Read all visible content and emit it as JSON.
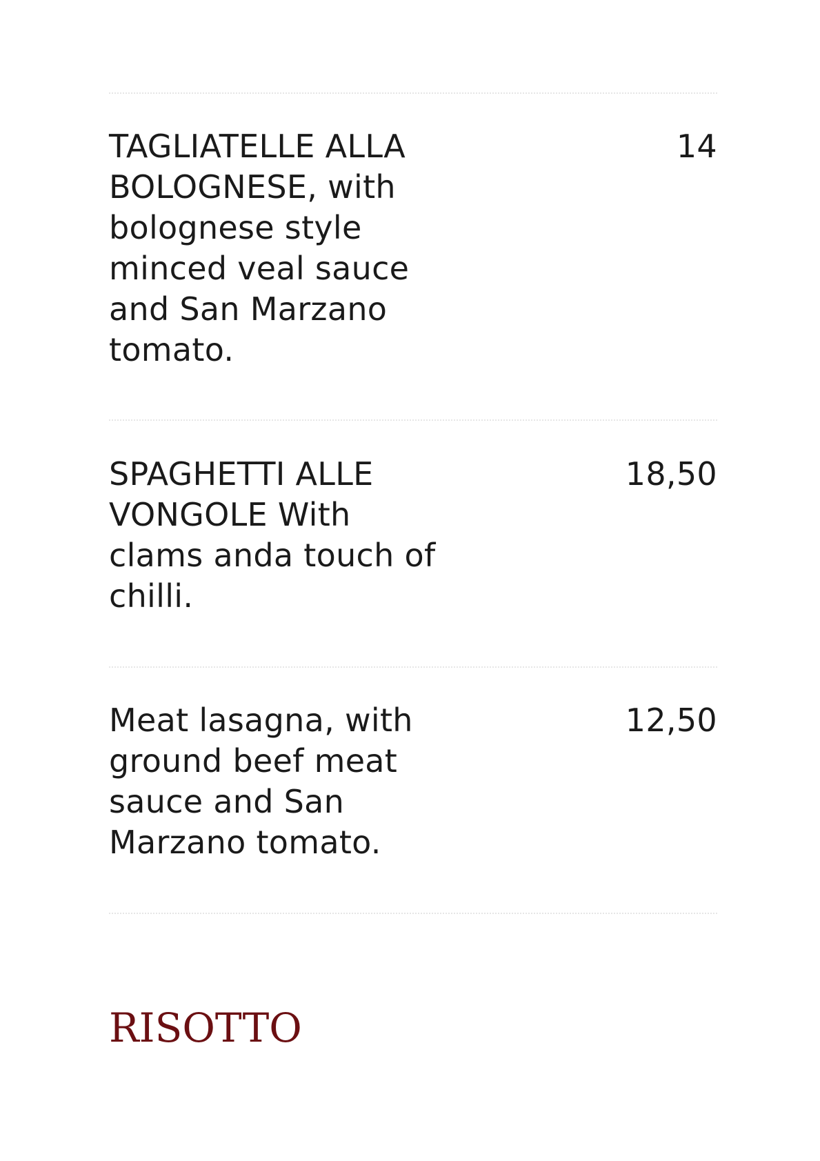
{
  "menu": {
    "items": [
      {
        "description": "TAGLIATELLE ALLA\nBOLOGNESE, with\nbolognese style\nminced veal sauce\nand San Marzano\ntomato.",
        "price": "14"
      },
      {
        "description": "SPAGHETTI ALLE\nVONGOLE With\nclams anda touch of\nchilli.",
        "price": "18,50"
      },
      {
        "description": "Meat lasagna, with\nground beef meat\nsauce and San\nMarzano tomato.",
        "price": "12,50"
      }
    ],
    "next_section_title": "RISOTTO"
  },
  "colors": {
    "text": "#1a1a1a",
    "section_title": "#6b0f12",
    "divider": "#e6e6e6",
    "background": "#ffffff"
  }
}
